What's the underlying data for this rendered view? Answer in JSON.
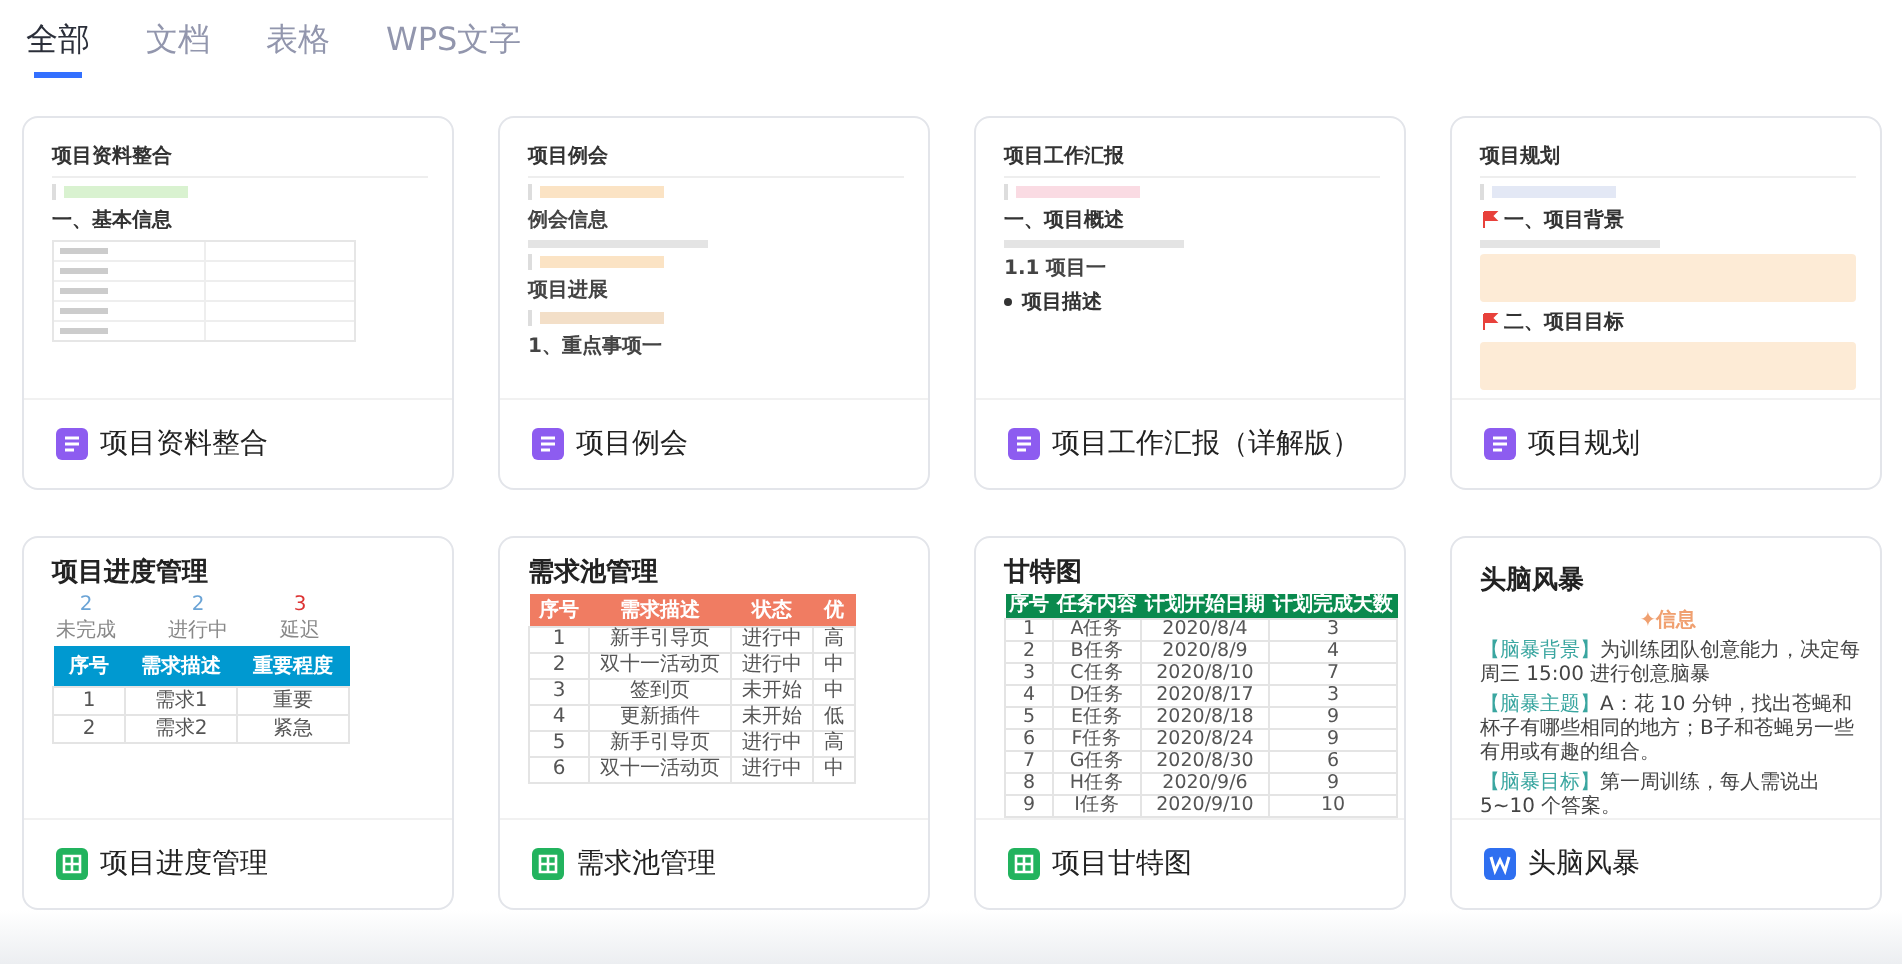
{
  "tabs": [
    {
      "label": "全部",
      "selected": true
    },
    {
      "label": "文档",
      "selected": false
    },
    {
      "label": "表格",
      "selected": false
    },
    {
      "label": "WPS文字",
      "selected": false
    }
  ],
  "templates": [
    {
      "name": "项目资料整合",
      "kind": "doc",
      "preview": {
        "kind": "doc",
        "blocks": [
          {
            "kind": "title",
            "text": "项目资料整合"
          },
          {
            "kind": "quote",
            "color": "#d9f2d0"
          },
          {
            "kind": "heading",
            "text": "一、基本信息"
          },
          {
            "kind": "form-table"
          }
        ]
      }
    },
    {
      "name": "项目例会",
      "kind": "doc",
      "preview": {
        "kind": "doc",
        "blocks": [
          {
            "kind": "title",
            "text": "项目例会"
          },
          {
            "kind": "quote",
            "color": "#fbe3c4"
          },
          {
            "kind": "subheading",
            "text": "例会信息"
          },
          {
            "kind": "bar"
          },
          {
            "kind": "quote",
            "color": "#fbe3c4"
          },
          {
            "kind": "subheading",
            "text": "项目进展"
          },
          {
            "kind": "quote",
            "color": "#f3dfc8"
          },
          {
            "kind": "subheading",
            "text": "1、重点事项一"
          }
        ]
      }
    },
    {
      "name": "项目工作汇报（详解版）",
      "kind": "doc",
      "preview": {
        "kind": "doc",
        "blocks": [
          {
            "kind": "title",
            "text": "项目工作汇报"
          },
          {
            "kind": "quote",
            "color": "#fadbe3"
          },
          {
            "kind": "heading",
            "text": "一、项目概述"
          },
          {
            "kind": "bar"
          },
          {
            "kind": "subheading",
            "text": "1.1 项目一"
          },
          {
            "kind": "bullet",
            "text": "项目描述"
          }
        ]
      }
    },
    {
      "name": "项目规划",
      "kind": "doc",
      "preview": {
        "kind": "doc",
        "blocks": [
          {
            "kind": "title",
            "text": "项目规划"
          },
          {
            "kind": "quote",
            "color": "#e3e8f5"
          },
          {
            "kind": "marked-heading",
            "text": "一、项目背景"
          },
          {
            "kind": "bar"
          },
          {
            "kind": "callout"
          },
          {
            "kind": "marked-heading",
            "text": "二、项目目标"
          },
          {
            "kind": "callout"
          }
        ]
      }
    },
    {
      "name": "项目进度管理",
      "kind": "sheet",
      "preview": {
        "kind": "progress",
        "title": "项目进度管理",
        "stats": [
          {
            "value": "2",
            "label": "未完成"
          },
          {
            "value": "2",
            "label": "进行中"
          },
          {
            "value": "3",
            "label": "延迟"
          }
        ],
        "columns": [
          "序号",
          "需求描述",
          "重要程度"
        ],
        "rows": [
          [
            "1",
            "需求1",
            "重要"
          ],
          [
            "2",
            "需求2",
            "紧急"
          ]
        ]
      }
    },
    {
      "name": "需求池管理",
      "kind": "sheet",
      "preview": {
        "kind": "pool",
        "title": "需求池管理",
        "columns": [
          "序号",
          "需求描述",
          "状态",
          "优"
        ],
        "rows": [
          [
            "1",
            "新手引导页",
            "进行中",
            "高"
          ],
          [
            "2",
            "双十一活动页",
            "进行中",
            "中"
          ],
          [
            "3",
            "签到页",
            "未开始",
            "中"
          ],
          [
            "4",
            "更新插件",
            "未开始",
            "低"
          ],
          [
            "5",
            "新手引导页",
            "进行中",
            "高"
          ],
          [
            "6",
            "双十一活动页",
            "进行中",
            "中"
          ]
        ]
      }
    },
    {
      "name": "项目甘特图",
      "kind": "sheet",
      "preview": {
        "kind": "gantt",
        "title": "甘特图",
        "columns": [
          "序号",
          "任务内容",
          "计划开始日期",
          "计划完成天数"
        ],
        "rows": [
          [
            "1",
            "A任务",
            "2020/8/4",
            "3"
          ],
          [
            "2",
            "B任务",
            "2020/8/9",
            "4"
          ],
          [
            "3",
            "C任务",
            "2020/8/10",
            "7"
          ],
          [
            "4",
            "D任务",
            "2020/8/17",
            "3"
          ],
          [
            "5",
            "E任务",
            "2020/8/18",
            "9"
          ],
          [
            "6",
            "F任务",
            "2020/8/24",
            "9"
          ],
          [
            "7",
            "G任务",
            "2020/8/30",
            "6"
          ],
          [
            "8",
            "H任务",
            "2020/9/6",
            "9"
          ],
          [
            "9",
            "I任务",
            "2020/9/10",
            "10"
          ]
        ]
      }
    },
    {
      "name": "头脑风暴",
      "kind": "wps",
      "preview": {
        "kind": "brainstorm",
        "title": "头脑风暴",
        "subtitle": "✦信息",
        "paragraphs": [
          {
            "label": "【脑暴背景】",
            "text": "为训练团队创意能力，决定每周三 15:00 进行创意脑暴"
          },
          {
            "label": "【脑暴主题】",
            "text": "A：花 10 分钟，找出苍蝇和杯子有哪些相同的地方；B子和苍蝇另一些有用或有趣的组合。"
          },
          {
            "label": "【脑暴目标】",
            "text": "第一周训练，每人需说出 5~10 个答案。"
          }
        ]
      }
    }
  ]
}
